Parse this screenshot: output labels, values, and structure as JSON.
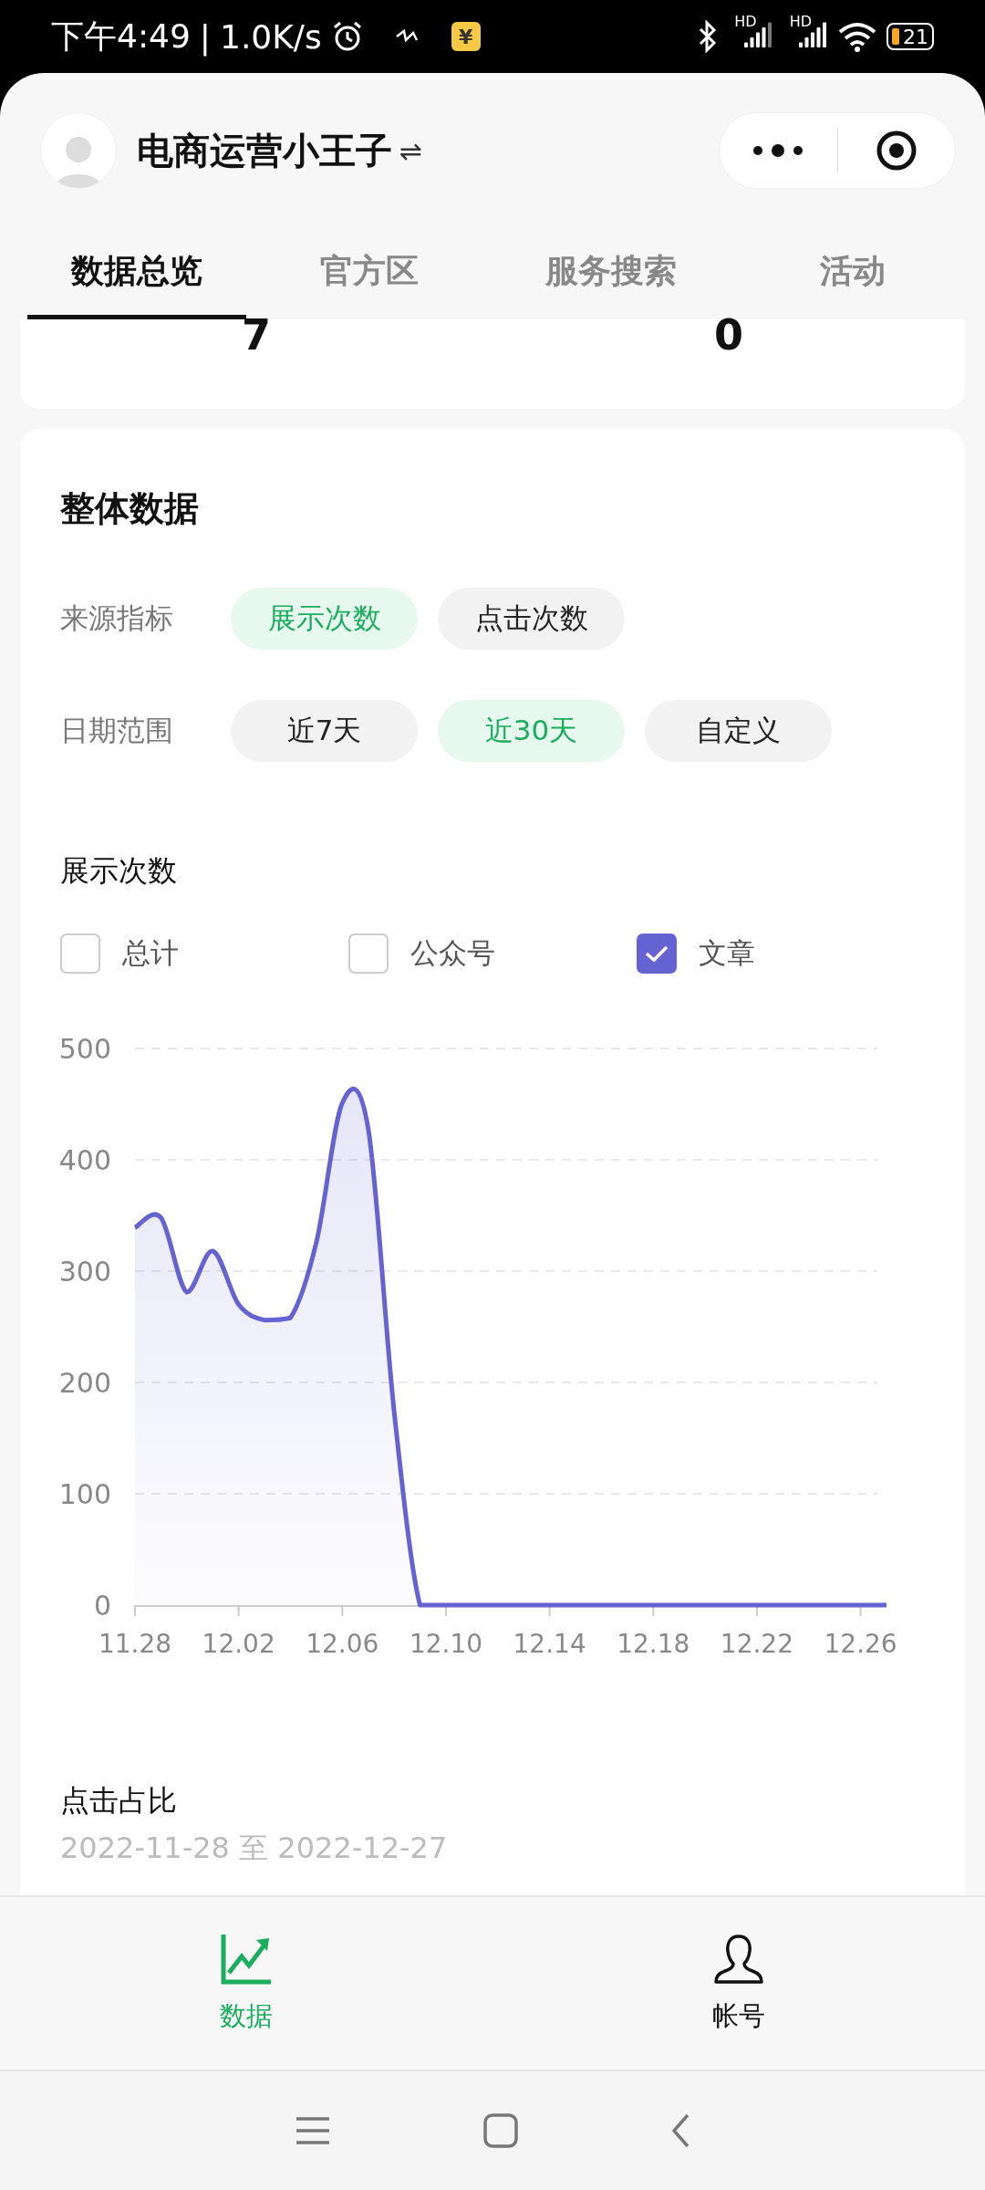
{
  "status_bar": {
    "time": "下午4:49",
    "separator": "|",
    "speed": "1.0K/s",
    "app_badge": "¥",
    "hd_labels": [
      "HD",
      "HD"
    ],
    "battery": "21"
  },
  "header": {
    "title": "电商运营小王子",
    "switch_glyph": "⇌"
  },
  "tabs": [
    {
      "label": "数据总览",
      "selected": true
    },
    {
      "label": "官方区",
      "selected": false
    },
    {
      "label": "服务搜索",
      "selected": false
    },
    {
      "label": "活动",
      "selected": false
    }
  ],
  "summary_values": [
    "7",
    "0"
  ],
  "overall": {
    "title": "整体数据",
    "filters": [
      {
        "label": "来源指标",
        "options": [
          {
            "label": "展示次数",
            "selected": true
          },
          {
            "label": "点击次数",
            "selected": false
          }
        ]
      },
      {
        "label": "日期范围",
        "options": [
          {
            "label": "近7天",
            "selected": false
          },
          {
            "label": "近30天",
            "selected": true
          },
          {
            "label": "自定义",
            "selected": false
          }
        ]
      }
    ],
    "metric_title": "展示次数",
    "series_toggles": [
      {
        "label": "总计",
        "checked": false
      },
      {
        "label": "公众号",
        "checked": false
      },
      {
        "label": "文章",
        "checked": true
      }
    ],
    "chart_data": {
      "type": "area",
      "categories": [
        "11.28",
        null,
        null,
        null,
        "12.02",
        null,
        null,
        null,
        "12.06",
        null,
        null,
        null,
        "12.10",
        null,
        null,
        null,
        "12.14",
        null,
        null,
        null,
        "12.18",
        null,
        null,
        null,
        "12.22",
        null,
        null,
        null,
        "12.26",
        null
      ],
      "grid": true,
      "series": [
        {
          "color": "#6563d1",
          "values": [
            339,
            348,
            281,
            318,
            270,
            256,
            258,
            326,
            451,
            428,
            174,
            0,
            0,
            0,
            0,
            0,
            0,
            0,
            0,
            0,
            0,
            0,
            0,
            0,
            0,
            0,
            0,
            0,
            0,
            0
          ]
        }
      ],
      "ylim": [
        0,
        500
      ],
      "yticks": [
        0,
        100,
        200,
        300,
        400,
        500
      ]
    },
    "ratio_title": "点击占比",
    "ratio_range": "2022-11-28 至 2022-12-27"
  },
  "bottom_nav": [
    {
      "label": "数据",
      "selected": true
    },
    {
      "label": "帐号",
      "selected": false
    }
  ]
}
